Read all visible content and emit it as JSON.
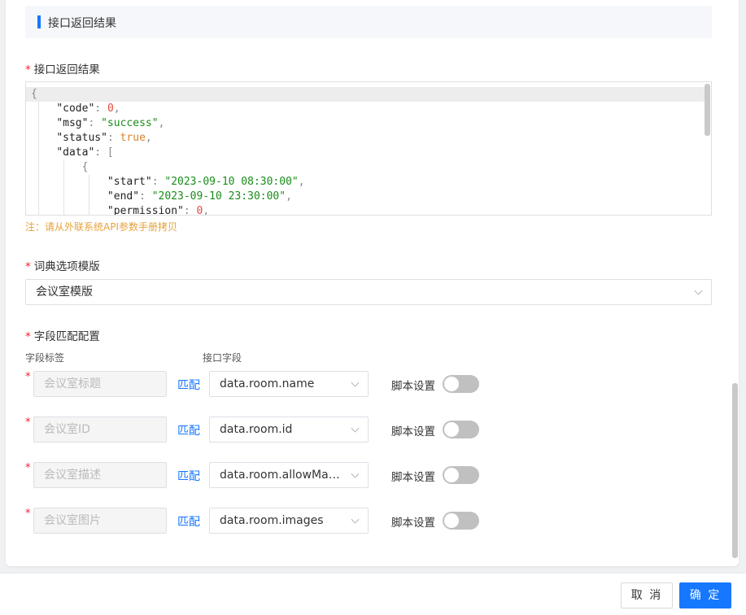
{
  "section": {
    "title": "接口返回结果"
  },
  "response": {
    "label": "接口返回结果",
    "required_mark": "*",
    "code_lines": [
      [
        {
          "t": "{",
          "c": "p"
        }
      ],
      [
        {
          "t": "    ",
          "c": "k"
        },
        {
          "t": "\"code\"",
          "c": "k"
        },
        {
          "t": ": ",
          "c": "p"
        },
        {
          "t": "0",
          "c": "n"
        },
        {
          "t": ",",
          "c": "p"
        }
      ],
      [
        {
          "t": "    ",
          "c": "k"
        },
        {
          "t": "\"msg\"",
          "c": "k"
        },
        {
          "t": ": ",
          "c": "p"
        },
        {
          "t": "\"success\"",
          "c": "s"
        },
        {
          "t": ",",
          "c": "p"
        }
      ],
      [
        {
          "t": "    ",
          "c": "k"
        },
        {
          "t": "\"status\"",
          "c": "k"
        },
        {
          "t": ": ",
          "c": "p"
        },
        {
          "t": "true",
          "c": "b"
        },
        {
          "t": ",",
          "c": "p"
        }
      ],
      [
        {
          "t": "    ",
          "c": "k"
        },
        {
          "t": "\"data\"",
          "c": "k"
        },
        {
          "t": ": [",
          "c": "p"
        }
      ],
      [
        {
          "t": "        ",
          "c": "k"
        },
        {
          "t": "{",
          "c": "p"
        }
      ],
      [
        {
          "t": "            ",
          "c": "k"
        },
        {
          "t": "\"start\"",
          "c": "k"
        },
        {
          "t": ": ",
          "c": "p"
        },
        {
          "t": "\"2023-09-10 08:30:00\"",
          "c": "s"
        },
        {
          "t": ",",
          "c": "p"
        }
      ],
      [
        {
          "t": "            ",
          "c": "k"
        },
        {
          "t": "\"end\"",
          "c": "k"
        },
        {
          "t": ": ",
          "c": "p"
        },
        {
          "t": "\"2023-09-10 23:30:00\"",
          "c": "s"
        },
        {
          "t": ",",
          "c": "p"
        }
      ],
      [
        {
          "t": "            ",
          "c": "k"
        },
        {
          "t": "\"permission\"",
          "c": "k"
        },
        {
          "t": ": ",
          "c": "p"
        },
        {
          "t": "0",
          "c": "n"
        },
        {
          "t": ",",
          "c": "p"
        }
      ]
    ],
    "note": "注：请从外联系统API参数手册拷贝"
  },
  "dict_template": {
    "label": "词典选项模版",
    "required_mark": "*",
    "value": "会议室模版"
  },
  "field_mapping": {
    "label": "字段匹配配置",
    "required_mark": "*",
    "col_field_label": "字段标签",
    "col_api_field": "接口字段",
    "match_text": "匹配",
    "script_text": "脚本设置",
    "rows": [
      {
        "placeholder": "会议室标题",
        "api_field": "data.room.name",
        "script_enabled": false
      },
      {
        "placeholder": "会议室ID",
        "api_field": "data.room.id",
        "script_enabled": false
      },
      {
        "placeholder": "会议室描述",
        "api_field": "data.room.allowMax...",
        "script_enabled": false
      },
      {
        "placeholder": "会议室图片",
        "api_field": "data.room.images",
        "script_enabled": false
      }
    ]
  },
  "footer": {
    "cancel_label": "取 消",
    "ok_label": "确 定"
  },
  "colors": {
    "accent": "#1677ff",
    "required": "#f5222d",
    "note": "#e6a23c",
    "switch_off": "#c0c0c0"
  }
}
